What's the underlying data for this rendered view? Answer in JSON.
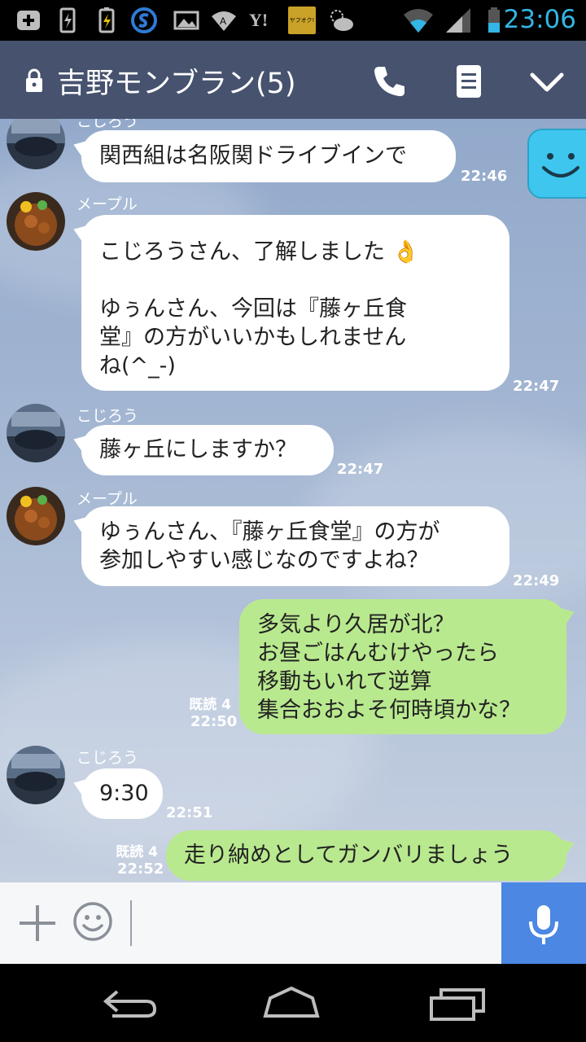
{
  "status_bar": {
    "time": "23:06",
    "icons": [
      "add-icon",
      "battery-charging-icon",
      "battery-icon",
      "s-app-icon",
      "image-icon",
      "wifi-a-icon",
      "yahoo-icon",
      "yafuoku-icon",
      "weather-icon",
      "wifi-signal-icon",
      "cell-signal-icon",
      "battery-level-icon"
    ],
    "yahoo_label": "Y!",
    "yafuoku_label": "ヤフオク!"
  },
  "header": {
    "title": "吉野モンブラン(5)",
    "buttons": [
      "phone-icon",
      "notes-icon",
      "chevron-down-icon"
    ]
  },
  "messages": [
    {
      "id": "m1",
      "sender": "こじろう",
      "text": "関西組は名阪関ドライブインで",
      "time": "22:46",
      "side": "left"
    },
    {
      "id": "m2",
      "sender": "メープル",
      "text": "こじろうさん、了解しました 👌\n\nゆぅんさん、今回は『藤ヶ丘食\n堂』の方がいいかもしれません\nね(^_-)",
      "time": "22:47",
      "side": "left"
    },
    {
      "id": "m3",
      "sender": "こじろう",
      "text": "藤ヶ丘にしますか？",
      "time": "22:47",
      "side": "left"
    },
    {
      "id": "m4",
      "sender": "メープル",
      "text": "ゆぅんさん、『藤ヶ丘食堂』の方が\n参加しやすい感じなのですよね？",
      "time": "22:49",
      "side": "left"
    },
    {
      "id": "m5",
      "sender": "",
      "text": "多気より久居が北？\nお昼ごはんむけやったら\n移動もいれて逆算\n集合おおよそ何時頃かな？",
      "time": "22:50",
      "read": "既読 4",
      "side": "right"
    },
    {
      "id": "m6",
      "sender": "こじろう",
      "text": "9:30",
      "time": "22:51",
      "side": "left"
    },
    {
      "id": "m7",
      "sender": "",
      "text": "走り納めとしてガンバリましょう",
      "time": "22:52",
      "read": "既読 4",
      "side": "right"
    }
  ],
  "input": {
    "placeholder": "",
    "value": ""
  },
  "nav": [
    "back-icon",
    "home-icon",
    "recents-icon"
  ]
}
